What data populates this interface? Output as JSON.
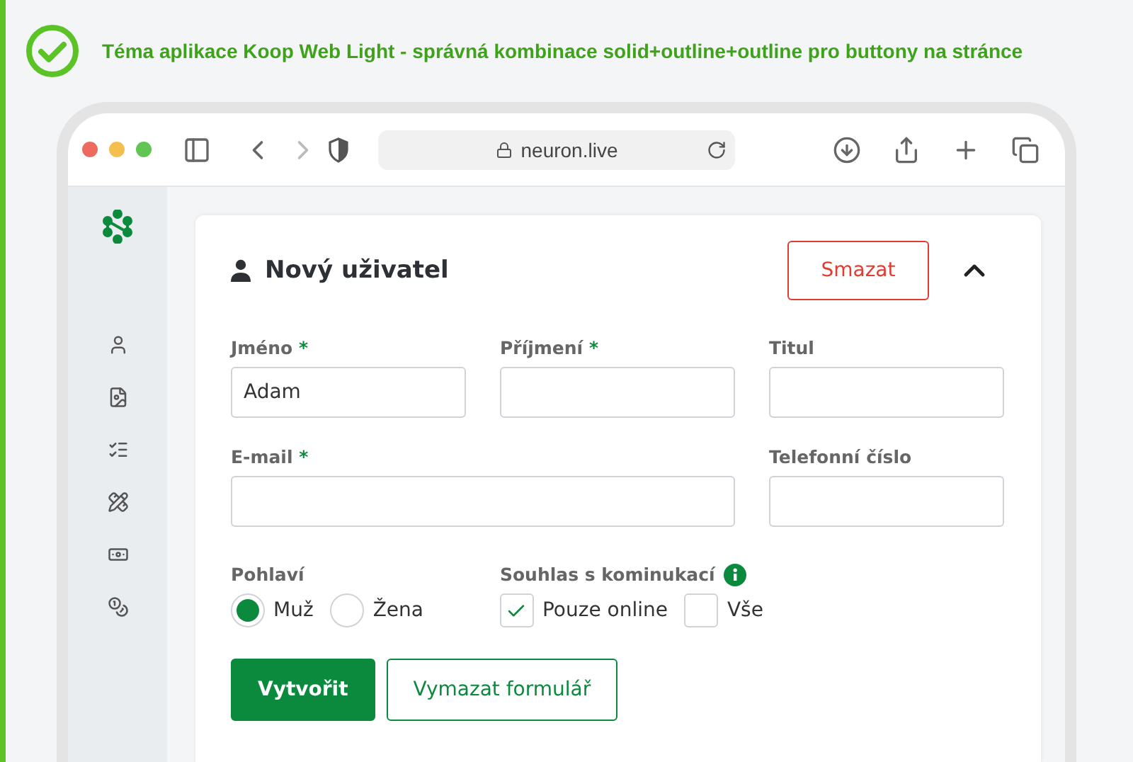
{
  "banner": {
    "text": "Téma aplikace Koop Web Light - správná kombinace solid+outline+outline pro buttony na stránce"
  },
  "browser": {
    "url": "neuron.live"
  },
  "card": {
    "title": "Nový uživatel",
    "delete_button": "Smazat",
    "expanded": true,
    "fields": [
      {
        "label": "Jméno",
        "required_mark": "*",
        "value": "Adam"
      },
      {
        "label": "Příjmení",
        "required_mark": "*"
      },
      {
        "label": "Titul"
      },
      {
        "label": "E-mail",
        "required_mark": "*"
      },
      {
        "label": "Telefonní číslo"
      }
    ],
    "gender": {
      "label": "Pohlaví",
      "options": [
        {
          "label": "Muž",
          "selected": true
        },
        {
          "label": "Žena",
          "selected": false
        }
      ]
    },
    "consent": {
      "label": "Souhlas s kominukací",
      "options": [
        {
          "label": "Pouze online",
          "checked": true
        },
        {
          "label": "Vše",
          "checked": false
        }
      ]
    },
    "buttons": [
      {
        "label": "Vytvořit",
        "kind": "solid"
      },
      {
        "label": "Vymazat formulář",
        "kind": "outline"
      }
    ]
  }
}
